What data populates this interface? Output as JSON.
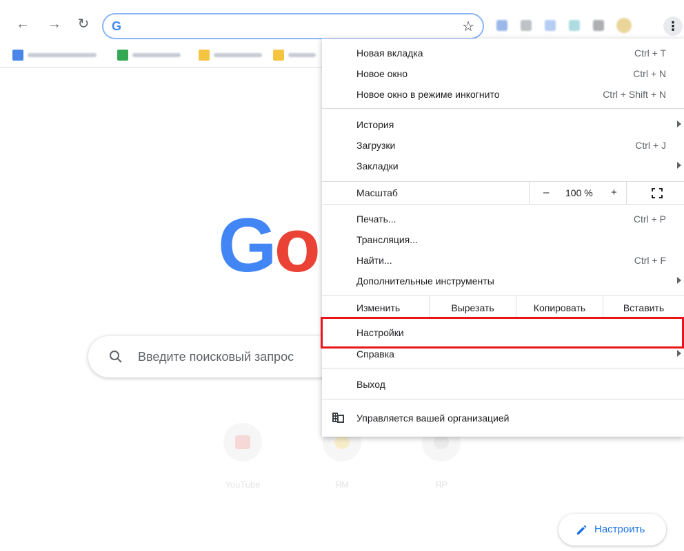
{
  "toolbar": {
    "back_icon": "arrow-left-icon",
    "forward_icon": "arrow-right-icon",
    "reload_icon": "reload-icon",
    "omnibox_value": "",
    "omnibox_logo": "G",
    "bookmark_star_icon": "star-icon",
    "menu_icon": "kebab-icon"
  },
  "ntp": {
    "logo_letters": [
      "G",
      "o"
    ],
    "search_placeholder": "Введите поисковый запрос",
    "shortcuts": [
      {
        "label": "YouTube",
        "color": "#ff0000"
      },
      {
        "label": "ЯМ",
        "color": "#ffcc00"
      },
      {
        "label": "ЯР",
        "color": "#9aa0a6"
      }
    ],
    "customize_label": "Настроить"
  },
  "menu": {
    "group1": [
      {
        "label": "Новая вкладка",
        "shortcut": "Ctrl + T"
      },
      {
        "label": "Новое окно",
        "shortcut": "Ctrl + N"
      },
      {
        "label": "Новое окно в режиме инкогнито",
        "shortcut": "Ctrl + Shift + N"
      }
    ],
    "group2": [
      {
        "label": "История",
        "shortcut": "",
        "submenu": true
      },
      {
        "label": "Загрузки",
        "shortcut": "Ctrl + J",
        "submenu": false
      },
      {
        "label": "Закладки",
        "shortcut": "",
        "submenu": true
      }
    ],
    "zoom": {
      "label": "Масштаб",
      "minus": "–",
      "value": "100 %",
      "plus": "+",
      "fullscreen_icon": "fullscreen-icon"
    },
    "group3": [
      {
        "label": "Печать...",
        "shortcut": "Ctrl + P",
        "submenu": false
      },
      {
        "label": "Трансляция...",
        "shortcut": "",
        "submenu": false
      },
      {
        "label": "Найти...",
        "shortcut": "Ctrl + F",
        "submenu": false
      },
      {
        "label": "Дополнительные инструменты",
        "shortcut": "",
        "submenu": true
      }
    ],
    "edit": {
      "label": "Изменить",
      "cut": "Вырезать",
      "copy": "Копировать",
      "paste": "Вставить"
    },
    "settings": "Настройки",
    "help": "Справка",
    "exit": "Выход",
    "managed": "Управляется вашей организацией",
    "highlight_color": "#e8161b"
  }
}
